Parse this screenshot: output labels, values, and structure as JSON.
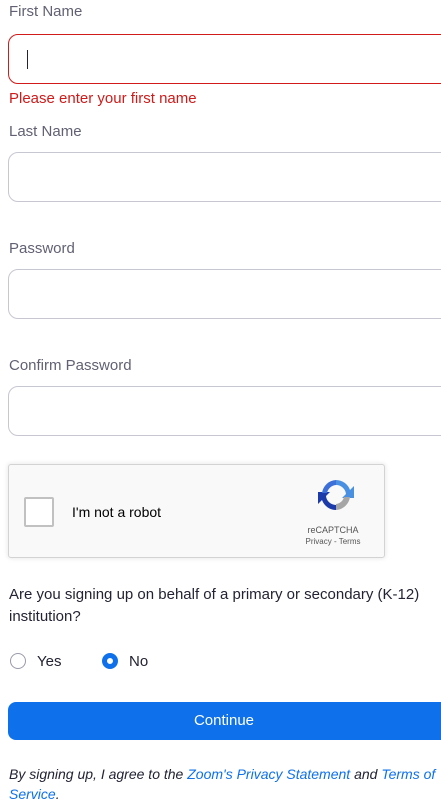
{
  "form": {
    "first_name": {
      "label": "First Name",
      "value": "",
      "error": "Please enter your first name"
    },
    "last_name": {
      "label": "Last Name",
      "value": ""
    },
    "password": {
      "label": "Password",
      "value": ""
    },
    "confirm_password": {
      "label": "Confirm Password",
      "value": ""
    }
  },
  "recaptcha": {
    "label": "I'm not a robot",
    "brand": "reCAPTCHA",
    "links": "Privacy - Terms",
    "icon": "recaptcha-logo-icon"
  },
  "k12": {
    "question": "Are you signing up on behalf of a primary or secondary (K-12) institution?",
    "options": [
      {
        "label": "Yes",
        "selected": false
      },
      {
        "label": "No",
        "selected": true
      }
    ]
  },
  "continue_label": "Continue",
  "terms": {
    "prefix": "By signing up, I agree to the ",
    "privacy_link": "Zoom's Privacy Statement",
    "middle": " and ",
    "tos_link": "Terms of Service",
    "suffix": "."
  },
  "colors": {
    "accent": "#0e71eb",
    "error": "#d11a1a",
    "input_border": "#c7c7d1"
  }
}
